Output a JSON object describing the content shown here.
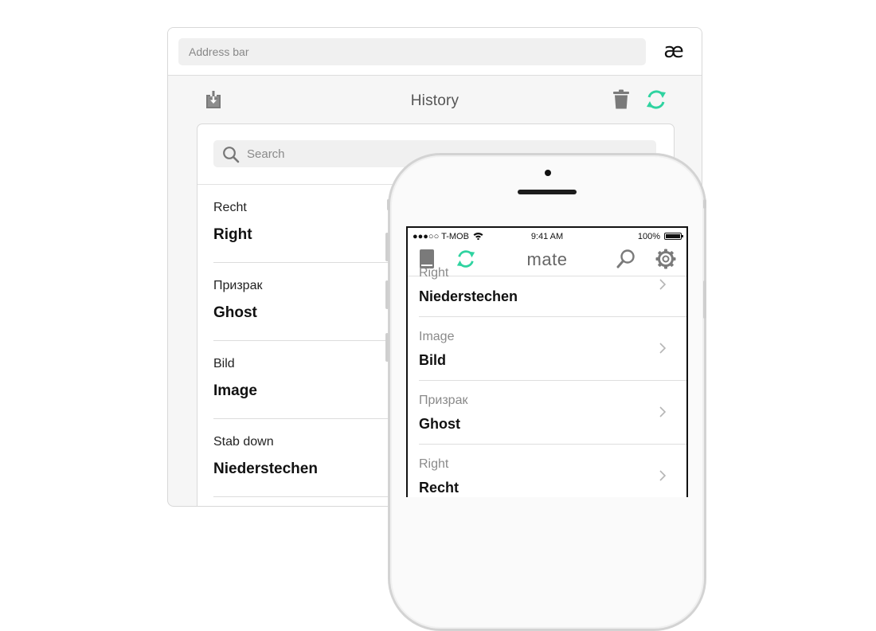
{
  "browser": {
    "address_placeholder": "Address bar",
    "logo_text": "æ"
  },
  "history": {
    "title": "History",
    "search_placeholder": "Search",
    "items": [
      {
        "source": "Recht",
        "target": "Right"
      },
      {
        "source": "Призрак",
        "target": "Ghost"
      },
      {
        "source": "Bild",
        "target": "Image"
      },
      {
        "source": "Stab down",
        "target": "Niederstechen"
      }
    ]
  },
  "phone": {
    "status": {
      "carrier": "●●●○○ T-MOB",
      "time": "9:41 AM",
      "battery": "100%"
    },
    "app_title": "mate",
    "items": [
      {
        "source": "Right",
        "target": "Niederstechen"
      },
      {
        "source": "Image",
        "target": "Bild"
      },
      {
        "source": "Призрак",
        "target": "Ghost"
      },
      {
        "source": "Right",
        "target": "Recht"
      }
    ]
  },
  "colors": {
    "accent": "#2fd3a0",
    "icon_gray": "#7a7a7a"
  }
}
